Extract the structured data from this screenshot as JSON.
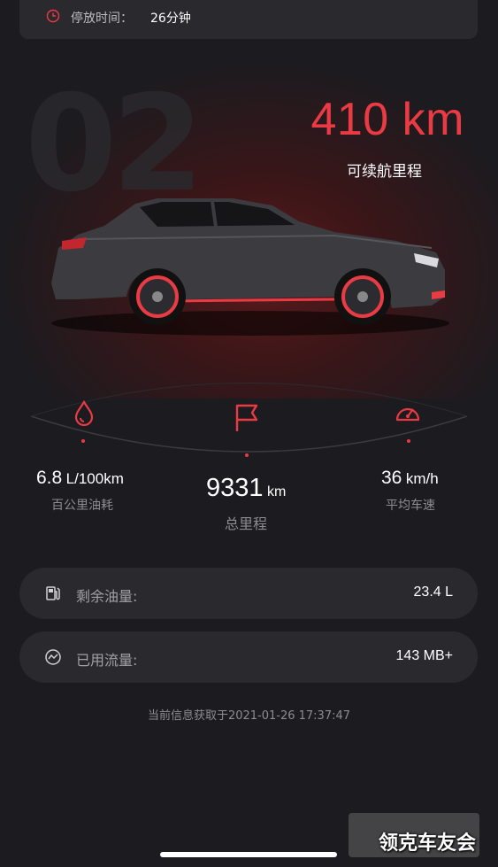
{
  "parking": {
    "label": "停放时间：",
    "value": "26分钟",
    "icon": "clock-icon"
  },
  "hero": {
    "background_number": "02",
    "range_value": "410 km",
    "range_label": "可续航里程",
    "accent_color": "#ea3b44"
  },
  "stats": [
    {
      "icon": "fuel-drop-icon",
      "number": "6.8",
      "unit": "L/100km",
      "label": "百公里油耗"
    },
    {
      "icon": "flag-icon",
      "number": "9331",
      "unit": "km",
      "label": "总里程"
    },
    {
      "icon": "speedometer-icon",
      "number": "36",
      "unit": "km/h",
      "label": "平均车速"
    }
  ],
  "info": [
    {
      "icon": "fuel-pump-icon",
      "label": "剩余油量:",
      "value": "23.4 L"
    },
    {
      "icon": "data-traffic-icon",
      "label": "已用流量:",
      "value": "143 MB+"
    }
  ],
  "updated_text": "当前信息获取于2021-01-26 17:37:47",
  "watermark": "领克车友会"
}
